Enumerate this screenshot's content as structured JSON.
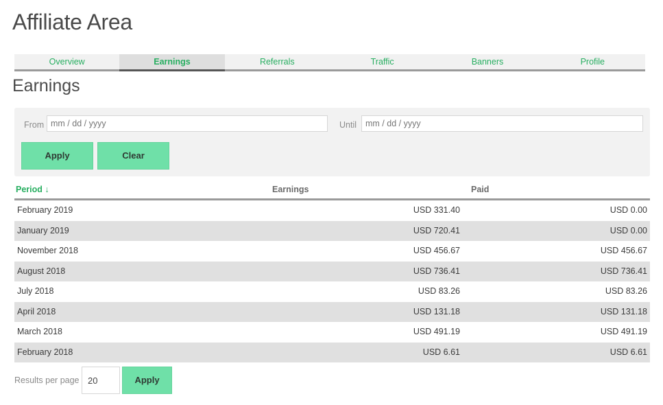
{
  "header": {
    "title": "Affiliate Area"
  },
  "tabs": [
    {
      "label": "Overview",
      "active": false
    },
    {
      "label": "Earnings",
      "active": true
    },
    {
      "label": "Referrals",
      "active": false
    },
    {
      "label": "Traffic",
      "active": false
    },
    {
      "label": "Banners",
      "active": false
    },
    {
      "label": "Profile",
      "active": false
    }
  ],
  "section": {
    "title": "Earnings"
  },
  "filters": {
    "from_label": "From",
    "from_placeholder": "mm / dd / yyyy",
    "until_label": "Until",
    "until_placeholder": "mm / dd / yyyy",
    "apply_label": "Apply",
    "clear_label": "Clear"
  },
  "table": {
    "columns": {
      "period": "Period",
      "sort_icon": "↓",
      "earnings": "Earnings",
      "paid": "Paid"
    },
    "rows": [
      {
        "period": "February 2019",
        "earnings": "USD 331.40",
        "paid": "USD 0.00"
      },
      {
        "period": "January 2019",
        "earnings": "USD 720.41",
        "paid": "USD 0.00"
      },
      {
        "period": "November 2018",
        "earnings": "USD 456.67",
        "paid": "USD 456.67"
      },
      {
        "period": "August 2018",
        "earnings": "USD 736.41",
        "paid": "USD 736.41"
      },
      {
        "period": "July 2018",
        "earnings": "USD 83.26",
        "paid": "USD 83.26"
      },
      {
        "period": "April 2018",
        "earnings": "USD 131.18",
        "paid": "USD 131.18"
      },
      {
        "period": "March 2018",
        "earnings": "USD 491.19",
        "paid": "USD 491.19"
      },
      {
        "period": "February 2018",
        "earnings": "USD 6.61",
        "paid": "USD 6.61"
      }
    ]
  },
  "pagination": {
    "results_label": "Results per page",
    "per_page_value": "20",
    "apply_label": "Apply"
  },
  "colors": {
    "accent": "#27ae60",
    "button": "#6fe0a8",
    "stripe": "#e0e0e0"
  }
}
